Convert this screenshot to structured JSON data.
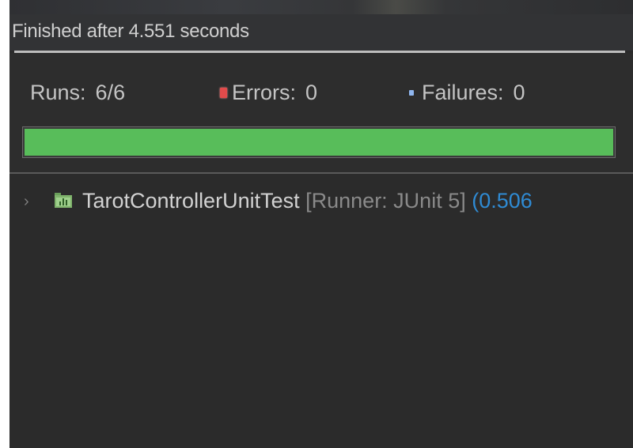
{
  "status": {
    "message": "Finished after 4.551 seconds"
  },
  "counters": {
    "runs_label": "Runs:",
    "runs_value": "6/6",
    "errors_label": "Errors:",
    "errors_value": "0",
    "failures_label": "Failures:",
    "failures_value": "0"
  },
  "progress": {
    "fraction": 1.0,
    "color": "#58bd5a"
  },
  "tree": {
    "items": [
      {
        "name": "TarotControllerUnitTest",
        "runner": "[Runner: JUnit 5]",
        "time": "(0.506",
        "icon": "test-folder-icon"
      }
    ]
  },
  "colors": {
    "panel_bg": "#2b2b2b",
    "error_red": "#e24b4b",
    "failure_blue": "#8fb6ef",
    "time_blue": "#2f8bd4"
  }
}
